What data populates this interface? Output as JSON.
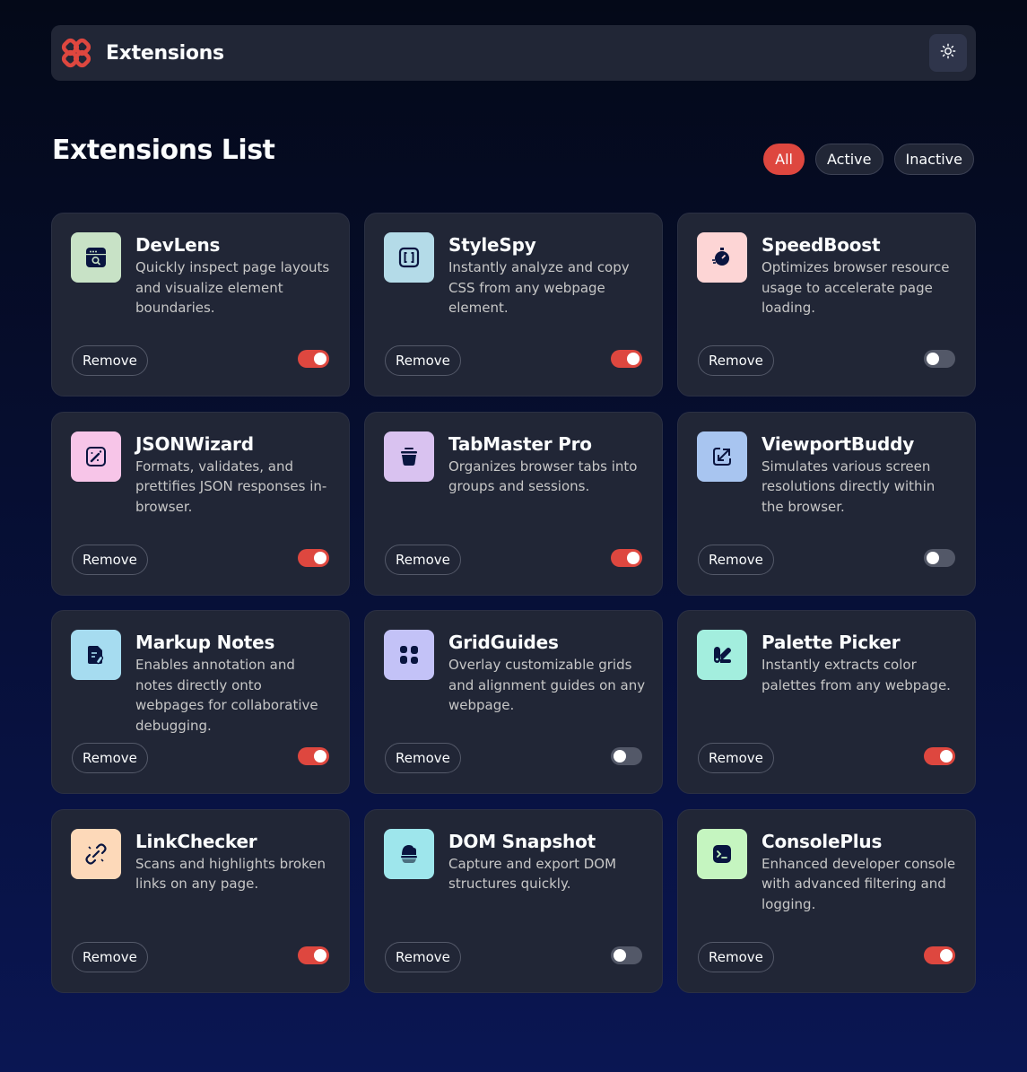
{
  "header": {
    "logo_text": "Extensions",
    "logo_icon": "flower-logo-icon",
    "theme_toggle_icon": "sun-icon"
  },
  "main": {
    "title": "Extensions List",
    "filters": [
      {
        "label": "All",
        "selected": true
      },
      {
        "label": "Active",
        "selected": false
      },
      {
        "label": "Inactive",
        "selected": false
      }
    ]
  },
  "colors": {
    "accent": "#de473f",
    "card_bg": "#212636",
    "text": "#fbfdfe",
    "muted_text": "#c7c7c7"
  },
  "extensions": [
    {
      "name": "DevLens",
      "description": "Quickly inspect page layouts and visualize element boundaries.",
      "remove_label": "Remove",
      "active": true,
      "icon": "inspect-window-icon",
      "icon_bg": "#c8e2c6"
    },
    {
      "name": "StyleSpy",
      "description": "Instantly analyze and copy CSS from any webpage element.",
      "remove_label": "Remove",
      "active": true,
      "icon": "brackets-icon",
      "icon_bg": "#b4dbe8"
    },
    {
      "name": "SpeedBoost",
      "description": "Optimizes browser resource usage to accelerate page loading.",
      "remove_label": "Remove",
      "active": false,
      "icon": "stopwatch-icon",
      "icon_bg": "#fdd5d5"
    },
    {
      "name": "JSONWizard",
      "description": "Formats, validates, and prettifies JSON responses in-browser.",
      "remove_label": "Remove",
      "active": true,
      "icon": "magic-wand-icon",
      "icon_bg": "#f7c5e8"
    },
    {
      "name": "TabMaster Pro",
      "description": "Organizes browser tabs into groups and sessions.",
      "remove_label": "Remove",
      "active": true,
      "icon": "tab-stack-icon",
      "icon_bg": "#d9c2f0"
    },
    {
      "name": "ViewportBuddy",
      "description": "Simulates various screen resolutions directly within the browser.",
      "remove_label": "Remove",
      "active": false,
      "icon": "resize-arrow-icon",
      "icon_bg": "#a8c5f0"
    },
    {
      "name": "Markup Notes",
      "description": "Enables annotation and notes directly onto webpages for collaborative debugging.",
      "remove_label": "Remove",
      "active": true,
      "icon": "note-pen-icon",
      "icon_bg": "#a6dcf0"
    },
    {
      "name": "GridGuides",
      "description": "Overlay customizable grids and alignment guides on any webpage.",
      "remove_label": "Remove",
      "active": false,
      "icon": "grid-blocks-icon",
      "icon_bg": "#c3c2f7"
    },
    {
      "name": "Palette Picker",
      "description": "Instantly extracts color palettes from any webpage.",
      "remove_label": "Remove",
      "active": true,
      "icon": "palette-icon",
      "icon_bg": "#a3eede"
    },
    {
      "name": "LinkChecker",
      "description": "Scans and highlights broken links on any page.",
      "remove_label": "Remove",
      "active": true,
      "icon": "broken-link-icon",
      "icon_bg": "#fdd9b9"
    },
    {
      "name": "DOM Snapshot",
      "description": "Capture and export DOM structures quickly.",
      "remove_label": "Remove",
      "active": false,
      "icon": "snapshot-icon",
      "icon_bg": "#9ee6ec"
    },
    {
      "name": "ConsolePlus",
      "description": "Enhanced developer console with advanced filtering and logging.",
      "remove_label": "Remove",
      "active": true,
      "icon": "terminal-icon",
      "icon_bg": "#c5f5c0"
    }
  ]
}
